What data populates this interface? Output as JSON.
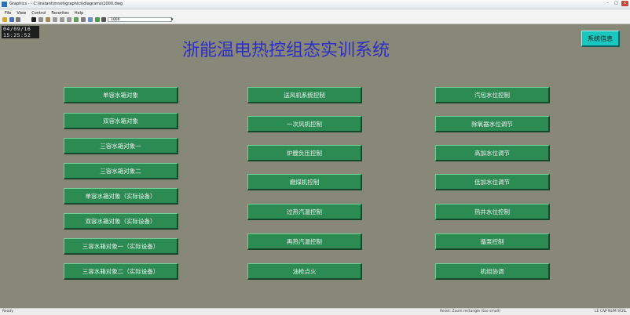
{
  "window": {
    "title": "Graphics - - C:\\Instant\\mnet\\graphics\\diagrams\\1000.dwg",
    "controls": {
      "minimize": "–",
      "maximize": "□",
      "close": "x"
    }
  },
  "menu": [
    "File",
    "View",
    "Control",
    "Favorites",
    "Help"
  ],
  "toolbar": {
    "zoom_value": "1000",
    "icons": [
      "open-folder-icon",
      "save-icon",
      "print-icon",
      "cut-icon",
      "copy-icon",
      "paste-icon",
      "back-icon",
      "forward-icon",
      "up-icon",
      "refresh-icon",
      "home-icon",
      "wifi-icon",
      "grid-icon",
      "zoom-icon"
    ]
  },
  "clock": {
    "date": "04/09/16",
    "time": "15:25:52"
  },
  "page": {
    "title": "浙能温电热控组态实训系统",
    "system_info_label": "系统信息"
  },
  "columns": {
    "left": [
      "单容水箱对象",
      "双容水箱对象",
      "三容水箱对象一",
      "三容水箱对象二",
      "单容水箱对象（实际设备）",
      "双容水箱对象（实际设备）",
      "三容水箱对象一（实际设备）",
      "三容水箱对象二（实际设备）"
    ],
    "middle": [
      "送风机系统控制",
      "一次风机控制",
      "炉膛负压控制",
      "磨煤机控制",
      "过热汽温控制",
      "再热汽温控制",
      "油枪点火"
    ],
    "right": [
      "汽包水位控制",
      "除氧器水位调节",
      "高加水位调节",
      "低加水位调节",
      "热井水位控制",
      "循泵控制",
      "机组协调"
    ]
  },
  "status": {
    "left": "Ready",
    "middle": "Reset: Zoom rectangle (too small)",
    "right": "LE CAP NUM SCRL"
  },
  "colors": {
    "canvas": "#888878",
    "button": "#2b8b52",
    "title": "#2e2ec2",
    "system_info": "#19c7be"
  }
}
